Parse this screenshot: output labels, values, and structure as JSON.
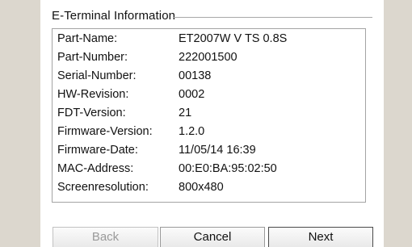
{
  "group": {
    "title": "E-Terminal Information"
  },
  "info": [
    {
      "label": "Part-Name:",
      "value": "ET2007W V TS 0.8S"
    },
    {
      "label": "Part-Number:",
      "value": "222001500"
    },
    {
      "label": "Serial-Number:",
      "value": "00138"
    },
    {
      "label": "HW-Revision:",
      "value": "0002"
    },
    {
      "label": "FDT-Version:",
      "value": "21"
    },
    {
      "label": "Firmware-Version:",
      "value": "1.2.0"
    },
    {
      "label": "Firmware-Date:",
      "value": "11/05/14 16:39"
    },
    {
      "label": "MAC-Address:",
      "value": "00:E0:BA:95:02:50"
    },
    {
      "label": "Screenresolution:",
      "value": "800x480"
    }
  ],
  "buttons": {
    "back": "Back",
    "cancel": "Cancel",
    "next": "Next"
  }
}
